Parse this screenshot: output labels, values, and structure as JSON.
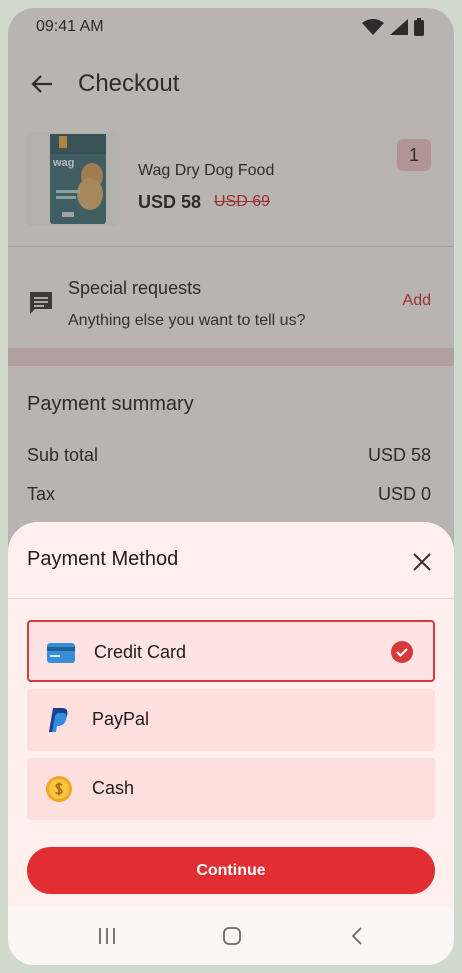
{
  "status_bar": {
    "time": "09:41 AM"
  },
  "app_bar": {
    "title": "Checkout"
  },
  "product": {
    "name": "Wag Dry Dog Food",
    "price": "USD 58",
    "old_price": "USD 69",
    "quantity": "1",
    "image_brand": "wag"
  },
  "special_requests": {
    "title": "Special requests",
    "subtitle": "Anything else you want to tell us?",
    "action": "Add"
  },
  "payment_summary": {
    "title": "Payment summary",
    "rows": [
      {
        "label": "Sub total",
        "value": "USD 58"
      },
      {
        "label": "Tax",
        "value": "USD 0"
      }
    ]
  },
  "payment_sheet": {
    "title": "Payment Method",
    "options": [
      {
        "label": "Credit Card",
        "icon": "credit-card-icon",
        "selected": true
      },
      {
        "label": "PayPal",
        "icon": "paypal-icon",
        "selected": false
      },
      {
        "label": "Cash",
        "icon": "cash-coin-icon",
        "selected": false
      }
    ],
    "continue_label": "Continue"
  },
  "colors": {
    "accent": "#e22e33",
    "selected_border": "#d9373b",
    "option_bg": "#fde0de",
    "sheet_bg": "#fff0ee"
  }
}
